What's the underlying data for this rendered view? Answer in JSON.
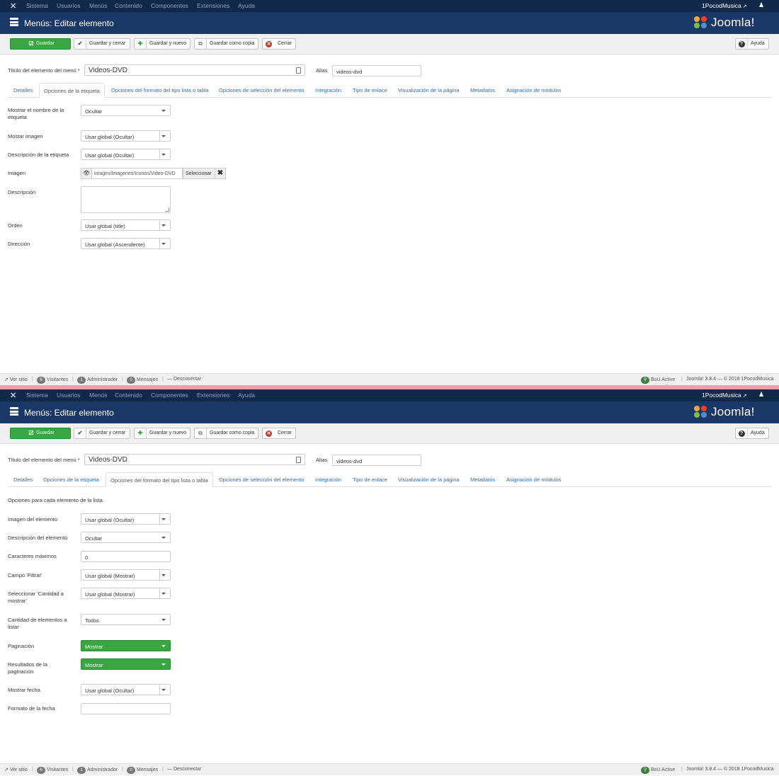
{
  "topbar": {
    "menu": [
      "Sistema",
      "Usuarios",
      "Menús",
      "Contenido",
      "Componentes",
      "Extensiones",
      "Ayuda"
    ],
    "site_name": "1PocodMusica",
    "user_icon": "user-icon"
  },
  "header": {
    "title": "Menús: Editar elemento",
    "logo_text": "Joomla!"
  },
  "toolbar": {
    "save": "Guardar",
    "save_close": "Guardar y cerrar",
    "save_new": "Guardar y nuevo",
    "save_copy": "Guardar como copia",
    "close": "Cerrar",
    "help": "Ayuda"
  },
  "title_field": {
    "label": "Título del elemento del menú *",
    "value": "Videos-DVD"
  },
  "alias_field": {
    "label": "Alias",
    "value": "videos-dvd"
  },
  "tabs": [
    "Detalles",
    "Opciones de la etiqueta",
    "Opciones del formato del tipo lista o tabla",
    "Opciones de selección del elemento",
    "Integración",
    "Tipo de enlace",
    "Visualización de la página",
    "Metadatos",
    "Asignación de módulos"
  ],
  "panel1": {
    "active_tab": 1,
    "fields": {
      "show_tag_name": {
        "label": "Mostrar el nombre de la etiqueta",
        "value": "Ocultar"
      },
      "show_image": {
        "label": "Mostar imagen",
        "value": "Usar global (Ocultar)"
      },
      "tag_description": {
        "label": "Descripción de la etiqueta",
        "value": "Usar global (Ocultar)"
      },
      "image": {
        "label": "Imagen",
        "value": "images/Imagenes/Iconos/Video-DVD",
        "select": "Seleccionar"
      },
      "description": {
        "label": "Descripción",
        "value": ""
      },
      "order": {
        "label": "Orden",
        "value": "Usar global (title)"
      },
      "direction": {
        "label": "Dirección",
        "value": "Usar global (Ascendente)"
      }
    }
  },
  "panel2": {
    "active_tab": 2,
    "intro": "Opciones para cada elemento de la lista.",
    "fields": {
      "item_image": {
        "label": "Imagen del elemento",
        "value": "Usar global (Ocultar)"
      },
      "item_description": {
        "label": "Descripción del elemento",
        "value": "Ocultar"
      },
      "max_chars": {
        "label": "Caracteres máximos",
        "value": "0"
      },
      "filter_field": {
        "label": "Campo 'Filtrar'",
        "value": "Usar global (Mostrar)"
      },
      "display_select": {
        "label": "Seleccionar 'Cantidad a mostrar'",
        "value": "Usar global (Mostrar)"
      },
      "num_items": {
        "label": "Cantidad de elementos a listar",
        "value": "Todos"
      },
      "pagination": {
        "label": "Paginación",
        "value": "Mostrar"
      },
      "pagination_results": {
        "label": "Resultados de la paginación",
        "value": "Mostrar"
      },
      "show_date": {
        "label": "Mostrar fecha",
        "value": "Usar global (Ocultar)"
      },
      "date_format": {
        "label": "Formato de la fecha",
        "value": ""
      }
    }
  },
  "statusbar": {
    "view_site": "Ver sitio",
    "visitors_count": "6",
    "visitors": "Visitantes",
    "admins_count": "1",
    "admins": "Administrador",
    "messages_count": "0",
    "messages": "Mensajes",
    "logout": "Desconectar",
    "bou_active": "BoU Active",
    "version": "Joomla! 3.8.4",
    "copyright": "— © 2018 1PocodMusica"
  },
  "colors": {
    "topbar": "#122a4a",
    "header": "#1a3867",
    "save_green": "#3aa541",
    "link_blue": "#2a69b8"
  }
}
